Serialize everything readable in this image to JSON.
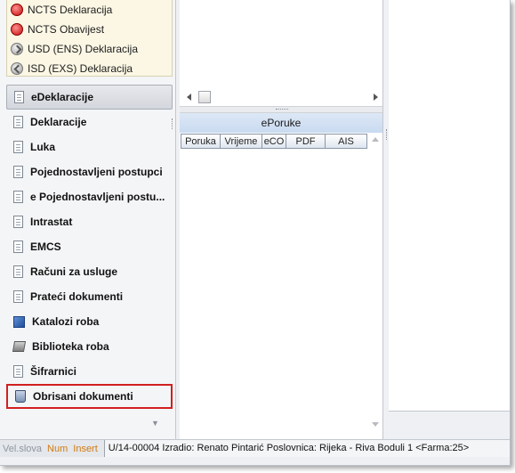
{
  "top_list": [
    {
      "label": "NCTS Deklaracija",
      "icon": "red-circle-icon"
    },
    {
      "label": "NCTS Obavijest",
      "icon": "red-circle-icon"
    },
    {
      "label": "USD (ENS) Deklaracija",
      "icon": "grey-arrow-icon"
    },
    {
      "label": "ISD (EXS) Deklaracija",
      "icon": "grey-back-arrow-icon"
    }
  ],
  "nav": [
    {
      "label": "eDeklaracije",
      "icon": "document-icon"
    },
    {
      "label": "Deklaracije",
      "icon": "document-icon"
    },
    {
      "label": "Luka",
      "icon": "document-icon"
    },
    {
      "label": "Pojednostavljeni postupci",
      "icon": "document-icon"
    },
    {
      "label": "e Pojednostavljeni postu...",
      "icon": "document-icon"
    },
    {
      "label": "Intrastat",
      "icon": "document-icon"
    },
    {
      "label": "EMCS",
      "icon": "document-icon"
    },
    {
      "label": "Računi za usluge",
      "icon": "document-icon"
    },
    {
      "label": "Prateći dokumenti",
      "icon": "document-icon"
    },
    {
      "label": "Katalozi roba",
      "icon": "cube-icon"
    },
    {
      "label": "Biblioteka roba",
      "icon": "book-icon"
    },
    {
      "label": "Šifrarnici",
      "icon": "document-icon"
    },
    {
      "label": "Obrisani dokumenti",
      "icon": "recycle-bin-icon"
    }
  ],
  "selected_nav": "eDeklaracije",
  "highlighted_nav": "Obrisani dokumenti",
  "eporuke": {
    "title": "ePoruke",
    "columns": [
      "Poruka",
      "Vrijeme",
      "eCO",
      "PDF",
      "AIS"
    ]
  },
  "status": {
    "vel_slova": "Vel.slova",
    "num": "Num",
    "insert": "Insert",
    "info": "U/14-00004  Izradio: Renato Pintarić  Poslovnica: Rijeka - Riva Boduli 1  <Farma:25>"
  },
  "colors": {
    "highlight_border": "#d21f1f",
    "pane_title_bg": "#c9daf0",
    "top_list_bg": "#fbf7e4"
  }
}
